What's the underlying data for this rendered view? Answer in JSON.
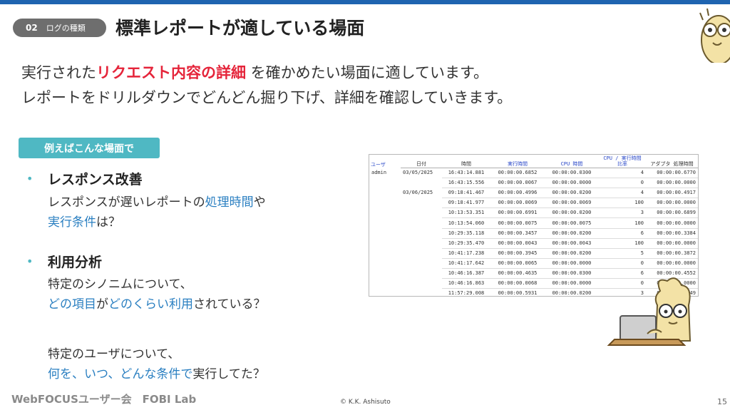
{
  "header": {
    "section_number": "02",
    "section_label": "ログの種類",
    "title": "標準レポートが適している場面"
  },
  "intro": {
    "line1_before": "実行された",
    "line1_highlight": "リクエスト内容の詳細",
    "line1_after": " を確かめたい場面に適しています。",
    "line2": "レポートをドリルダウンでどんどん掘り下げ、詳細を確認していきます。"
  },
  "example_label": "例えばこんな場面で",
  "items": [
    {
      "heading": "レスポンス改善",
      "l1_a": "レスポンスが遅いレポートの",
      "l1_b": "処理時間",
      "l1_c": "や",
      "l2_a": "実行条件",
      "l2_b": "は？"
    },
    {
      "heading": "利用分析",
      "l1": "特定のシノニムについて、",
      "l2_a": "どの項目",
      "l2_b": "が",
      "l2_c": "どのくらい利用",
      "l2_d": "されている？",
      "l3": "特定のユーザについて、",
      "l4_a": "何を、いつ、どんな条件で",
      "l4_b": "実行してた？"
    }
  ],
  "report": {
    "headers": [
      "ユーザ",
      "日付",
      "時間",
      "実行時間",
      "CPU 時間",
      "CPU / 実行時間 比率",
      "アダプタ 処理時間"
    ],
    "rows": [
      [
        "admin",
        "03/05/2025",
        "16:43:14.881",
        "00:00:00.6852",
        "00:00:00.0300",
        "4",
        "00:00:00.6770"
      ],
      [
        "",
        "",
        "16:43:15.556",
        "00:00:00.0067",
        "00:00:00.0000",
        "0",
        "00:00:00.0000"
      ],
      [
        "",
        "03/06/2025",
        "09:18:41.467",
        "00:00:00.4996",
        "00:00:00.0200",
        "4",
        "00:00:00.4917"
      ],
      [
        "",
        "",
        "09:18:41.977",
        "00:00:00.0069",
        "00:00:00.0069",
        "100",
        "00:00:00.0000"
      ],
      [
        "",
        "",
        "10:13:53.351",
        "00:00:00.6991",
        "00:00:00.0200",
        "3",
        "00:00:00.6899"
      ],
      [
        "",
        "",
        "10:13:54.060",
        "00:00:00.0075",
        "00:00:00.0075",
        "100",
        "00:00:00.0000"
      ],
      [
        "",
        "",
        "10:29:35.118",
        "00:00:00.3457",
        "00:00:00.0200",
        "6",
        "00:00:00.3384"
      ],
      [
        "",
        "",
        "10:29:35.470",
        "00:00:00.0043",
        "00:00:00.0043",
        "100",
        "00:00:00.0000"
      ],
      [
        "",
        "",
        "10:41:17.238",
        "00:00:00.3945",
        "00:00:00.0200",
        "5",
        "00:00:00.3872"
      ],
      [
        "",
        "",
        "10:41:17.642",
        "00:00:00.0065",
        "00:00:00.0000",
        "0",
        "00:00:00.0000"
      ],
      [
        "",
        "",
        "10:46:16.387",
        "00:00:00.4635",
        "00:00:00.0300",
        "6",
        "00:00:00.4552"
      ],
      [
        "",
        "",
        "10:46:16.863",
        "00:00:00.0068",
        "00:00:00.0000",
        "0",
        "00:00:00.0000"
      ],
      [
        "",
        "",
        "11:57:29.008",
        "00:00:00.5931",
        "00:00:00.0200",
        "3",
        "00:00:00.5849"
      ]
    ]
  },
  "footer": {
    "brand": "WebFOCUSユーザー会　FOBI Lab",
    "copyright": "© K.K. Ashisuto",
    "page": "15"
  },
  "colors": {
    "accent_blue": "#1f64b0",
    "highlight_red": "#e5243a",
    "teal": "#4fb8c3",
    "link_blue": "#2a7fc1"
  }
}
